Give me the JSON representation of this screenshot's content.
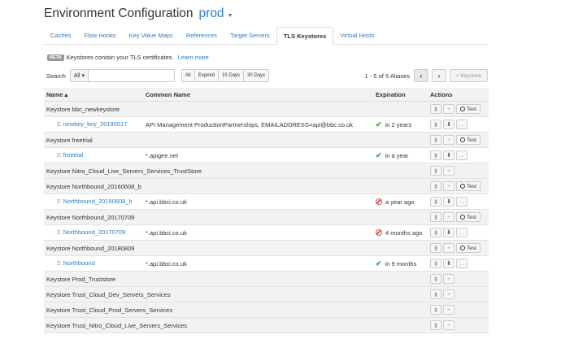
{
  "header": {
    "title": "Environment Configuration",
    "env": "prod"
  },
  "tabs": [
    "Caches",
    "Flow Hooks",
    "Key Value Maps",
    "References",
    "Target Servers",
    "TLS Keystores",
    "Virtual Hosts"
  ],
  "active_tab": 5,
  "notice": {
    "badge": "BETA",
    "text": "Keystores contain your TLS certificates.",
    "link": "Learn more"
  },
  "filter": {
    "label": "Search",
    "select_value": "All",
    "search_value": "",
    "buttons": [
      "All",
      "Expired",
      "15 Days",
      "30 Days"
    ],
    "count": "1 - 5 of 5 Aliases",
    "add_label": "+ Keystore"
  },
  "columns": {
    "name": "Name ▴",
    "cn": "Common Name",
    "exp": "Expiration",
    "act": "Actions"
  },
  "rows": [
    {
      "type": "group",
      "name": "Keystore bbc_newkeystore",
      "test": true
    },
    {
      "type": "alias",
      "name": "newkey_key_20190517",
      "cn": "API Management ProductionPartnerships, EMAILADDRESS=api@bbc.co.uk",
      "status": "ok",
      "exp": "in 2 years"
    },
    {
      "type": "group",
      "name": "Keystore freetrial",
      "test": true
    },
    {
      "type": "alias",
      "name": "freetrial",
      "cn": "*.apigee.net",
      "status": "ok",
      "exp": "in a year"
    },
    {
      "type": "group",
      "name": "Keystore Nitro_Cloud_Live_Servers_Services_TrustStore",
      "test": false
    },
    {
      "type": "group",
      "name": "Keystore Northbound_20160608_b",
      "test": true
    },
    {
      "type": "alias",
      "name": "Northbound_20160608_b",
      "cn": "*.api.bbci.co.uk",
      "status": "bad",
      "exp": "a year ago"
    },
    {
      "type": "group",
      "name": "Keystore Northbound_20170709",
      "test": true
    },
    {
      "type": "alias",
      "name": "Northbound_20170709",
      "cn": "*.api.bbci.co.uk",
      "status": "bad",
      "exp": "4 months ago"
    },
    {
      "type": "group",
      "name": "Keystore Northbound_20180809",
      "test": true
    },
    {
      "type": "alias",
      "name": "Northbound",
      "cn": "*.api.bbci.co.uk",
      "status": "ok",
      "exp": "in 9 months"
    },
    {
      "type": "group",
      "name": "Keystore Prod_Truststore",
      "test": false
    },
    {
      "type": "group",
      "name": "Keystore Trust_Cloud_Dev_Servers_Services",
      "test": false
    },
    {
      "type": "group",
      "name": "Keystore Trust_Cloud_Prod_Servers_Services",
      "test": false
    },
    {
      "type": "group",
      "name": "Keystore Trust_Nitro_Cloud_Live_Servers_Services",
      "test": false
    }
  ],
  "action_labels": {
    "delete": "🗑",
    "add": "+",
    "test": "Test",
    "download": "⬇",
    "more": "..."
  },
  "colors": {
    "link": "#2e7bc4",
    "ok": "#3aa53a",
    "bad": "#d9534f"
  }
}
